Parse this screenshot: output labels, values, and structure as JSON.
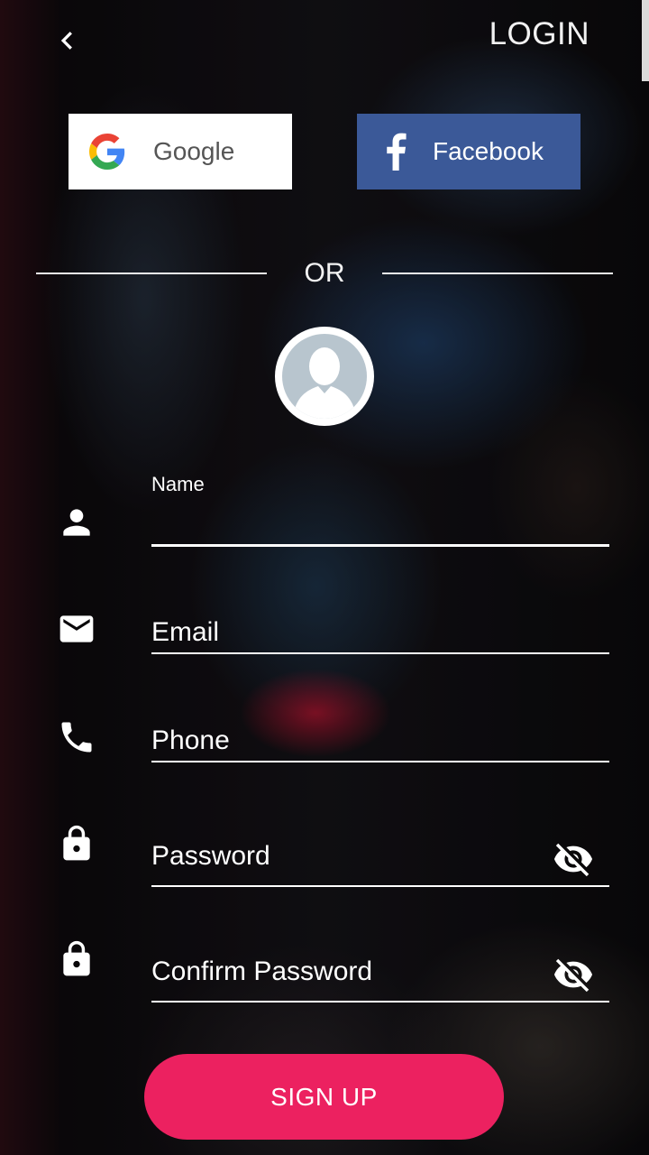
{
  "header": {
    "back_icon": "chevron-left-icon",
    "login_label": "LOGIN"
  },
  "social": {
    "google_label": "Google",
    "facebook_label": "Facebook",
    "google_icon": "google-g-icon",
    "facebook_icon": "facebook-f-icon",
    "facebook_color": "#3b5998"
  },
  "divider": {
    "or_label": "OR"
  },
  "avatar": {
    "icon": "avatar-placeholder-icon"
  },
  "form": {
    "name": {
      "label": "Name",
      "value": "",
      "icon": "person-icon"
    },
    "email": {
      "placeholder": "Email",
      "icon": "mail-icon"
    },
    "phone": {
      "placeholder": "Phone",
      "icon": "phone-icon"
    },
    "password": {
      "placeholder": "Password",
      "icon": "lock-icon",
      "toggle_icon": "eye-off-icon"
    },
    "confirm_password": {
      "placeholder": "Confirm Password",
      "icon": "lock-icon",
      "toggle_icon": "eye-off-icon"
    }
  },
  "actions": {
    "signup_label": "SIGN UP",
    "signup_color": "#ec2160"
  }
}
